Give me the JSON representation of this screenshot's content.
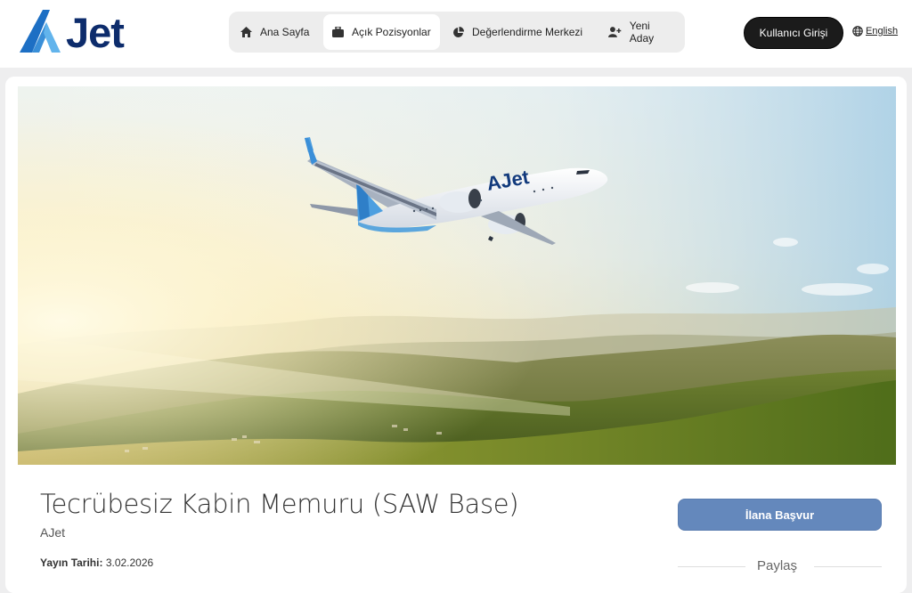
{
  "brand": {
    "name": "Jet",
    "primary_color": "#0d2c6c",
    "accent_color": "#3a8fd8"
  },
  "nav": {
    "items": [
      {
        "label": "Ana Sayfa",
        "icon": "home-icon",
        "active": false
      },
      {
        "label": "Açık Pozisyonlar",
        "icon": "briefcase-icon",
        "active": true
      },
      {
        "label": "Değerlendirme Merkezi",
        "icon": "pie-chart-icon",
        "active": false
      },
      {
        "label": "Yeni Aday",
        "icon": "user-plus-icon",
        "active": false
      }
    ]
  },
  "header": {
    "login_label": "Kullanıcı Girişi",
    "language_label": "English"
  },
  "hero": {
    "aircraft_livery": "AJet"
  },
  "job": {
    "title": "Tecrübesiz Kabin Memuru (SAW Base)",
    "company": "AJet",
    "published_label": "Yayın Tarihi:",
    "published_date": "3.02.2026"
  },
  "actions": {
    "apply_label": "İlana Başvur",
    "share_label": "Paylaş"
  }
}
